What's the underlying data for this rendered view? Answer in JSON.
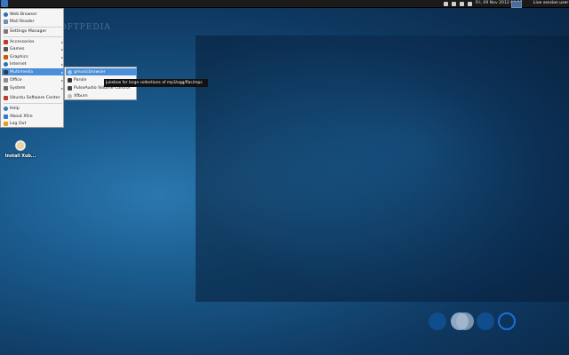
{
  "panel": {
    "clock": "Fri, 09 Nov 2012 08:27",
    "session": "Live session user"
  },
  "watermark": "SOFTPEDIA",
  "menu": {
    "items": [
      {
        "label": "Web Browser",
        "icon": "web-browser-icon",
        "color": "#2f6db5"
      },
      {
        "label": "Mail Reader",
        "icon": "mail-icon",
        "color": "#6b8fb8"
      },
      {
        "label": "Settings Manager",
        "icon": "settings-icon",
        "color": "#7a7a7a"
      },
      {
        "label": "Accessories",
        "icon": "accessories-icon",
        "color": "#c0392b"
      },
      {
        "label": "Games",
        "icon": "games-icon",
        "color": "#555555"
      },
      {
        "label": "Graphics",
        "icon": "graphics-icon",
        "color": "#d35400"
      },
      {
        "label": "Internet",
        "icon": "internet-icon",
        "color": "#2e6fb5"
      },
      {
        "label": "Multimedia",
        "icon": "multimedia-icon",
        "color": "#2c3e50"
      },
      {
        "label": "Office",
        "icon": "office-icon",
        "color": "#8e8e8e"
      },
      {
        "label": "System",
        "icon": "system-icon",
        "color": "#6d6d6d"
      },
      {
        "label": "Ubuntu Software Center",
        "icon": "software-center-icon",
        "color": "#c0392b"
      },
      {
        "label": "Help",
        "icon": "help-icon",
        "color": "#3a79c4"
      },
      {
        "label": "About Xfce",
        "icon": "about-icon",
        "color": "#3a79c4"
      },
      {
        "label": "Log Out",
        "icon": "logout-icon",
        "color": "#e0a020"
      }
    ]
  },
  "submenu": {
    "items": [
      {
        "label": "gmusicbrowser",
        "icon": "gmusicbrowser-icon",
        "color": "#3a79c4"
      },
      {
        "label": "Parole",
        "icon": "parole-icon",
        "color": "#333333"
      },
      {
        "label": "PulseAudio Volume Control",
        "icon": "volume-icon",
        "color": "#444444"
      },
      {
        "label": "Xfburn",
        "icon": "xfburn-icon",
        "color": "#9a9a9a"
      }
    ]
  },
  "tooltip": "Jukebox for large collections of mp3/ogg/flac/mpc",
  "desktop": {
    "icon_label": "Install Xub..."
  }
}
